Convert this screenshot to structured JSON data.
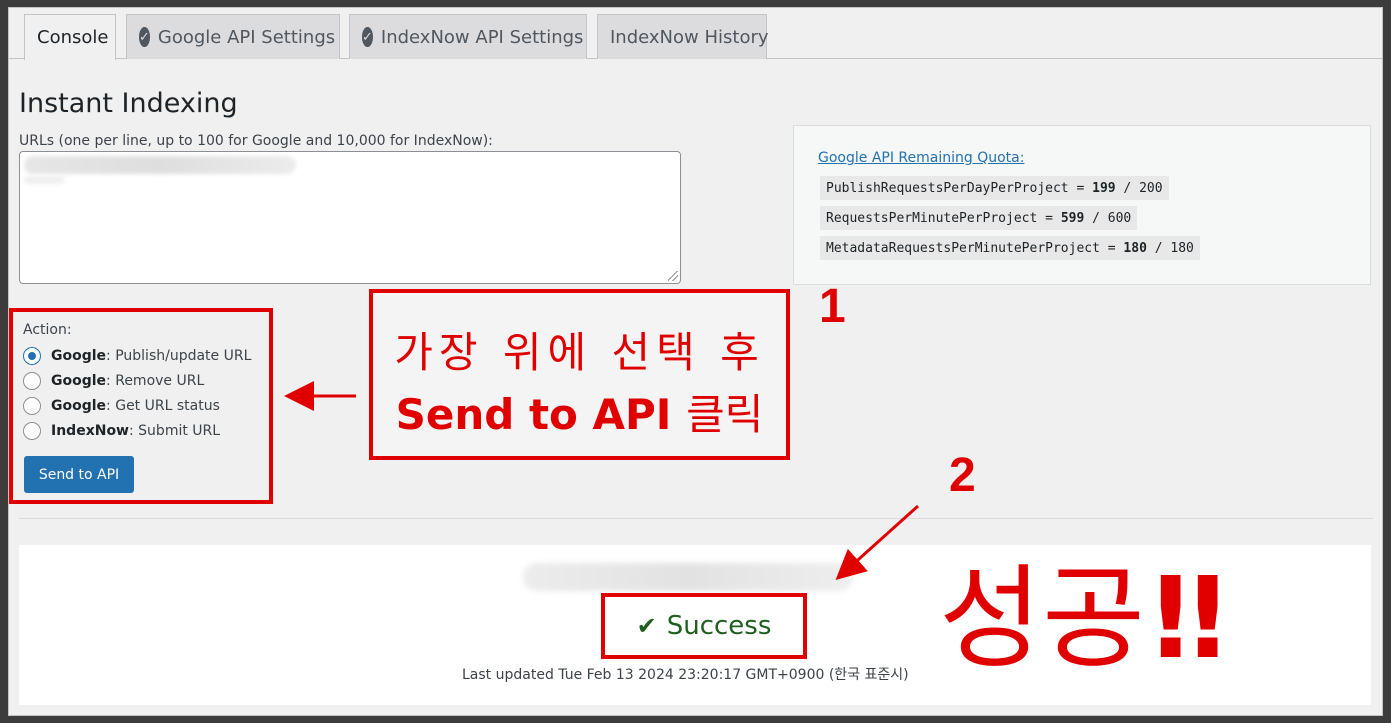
{
  "tabs": [
    {
      "label": "Console",
      "active": true,
      "checked": false
    },
    {
      "label": "Google API Settings",
      "active": false,
      "checked": true
    },
    {
      "label": "IndexNow API Settings",
      "active": false,
      "checked": true
    },
    {
      "label": "IndexNow History",
      "active": false,
      "checked": false
    }
  ],
  "page": {
    "title": "Instant Indexing",
    "urls_label": "URLs (one per line, up to 100 for Google and 10,000 for IndexNow):"
  },
  "quota": {
    "title": "Google API Remaining Quota:",
    "rows": [
      {
        "name": "PublishRequestsPerDayPerProject",
        "remaining": "199",
        "limit": "200"
      },
      {
        "name": "RequestsPerMinutePerProject",
        "remaining": "599",
        "limit": "600"
      },
      {
        "name": "MetadataRequestsPerMinutePerProject",
        "remaining": "180",
        "limit": "180"
      }
    ]
  },
  "action": {
    "label": "Action:",
    "options": [
      {
        "service": "Google",
        "text": ": Publish/update URL",
        "selected": true
      },
      {
        "service": "Google",
        "text": ": Remove URL",
        "selected": false
      },
      {
        "service": "Google",
        "text": ": Get URL status",
        "selected": false
      },
      {
        "service": "IndexNow",
        "text": ": Submit URL",
        "selected": false
      }
    ],
    "send_label": "Send to API"
  },
  "annotations": {
    "callout_line1": "가장 위에 선택 후",
    "callout_line2_en": "Send to API",
    "callout_line2_ko": "클릭",
    "step1": "1",
    "step2": "2",
    "big_text": "성공",
    "big_bang": "!!"
  },
  "result": {
    "success_label": "Success",
    "updated_text": "Last updated Tue Feb 13 2024 23:20:17 GMT+0900 (한국 표준시)"
  },
  "colors": {
    "accent": "#2271b1",
    "annotation_red": "#e00000",
    "success_green": "#1e5e1e"
  }
}
